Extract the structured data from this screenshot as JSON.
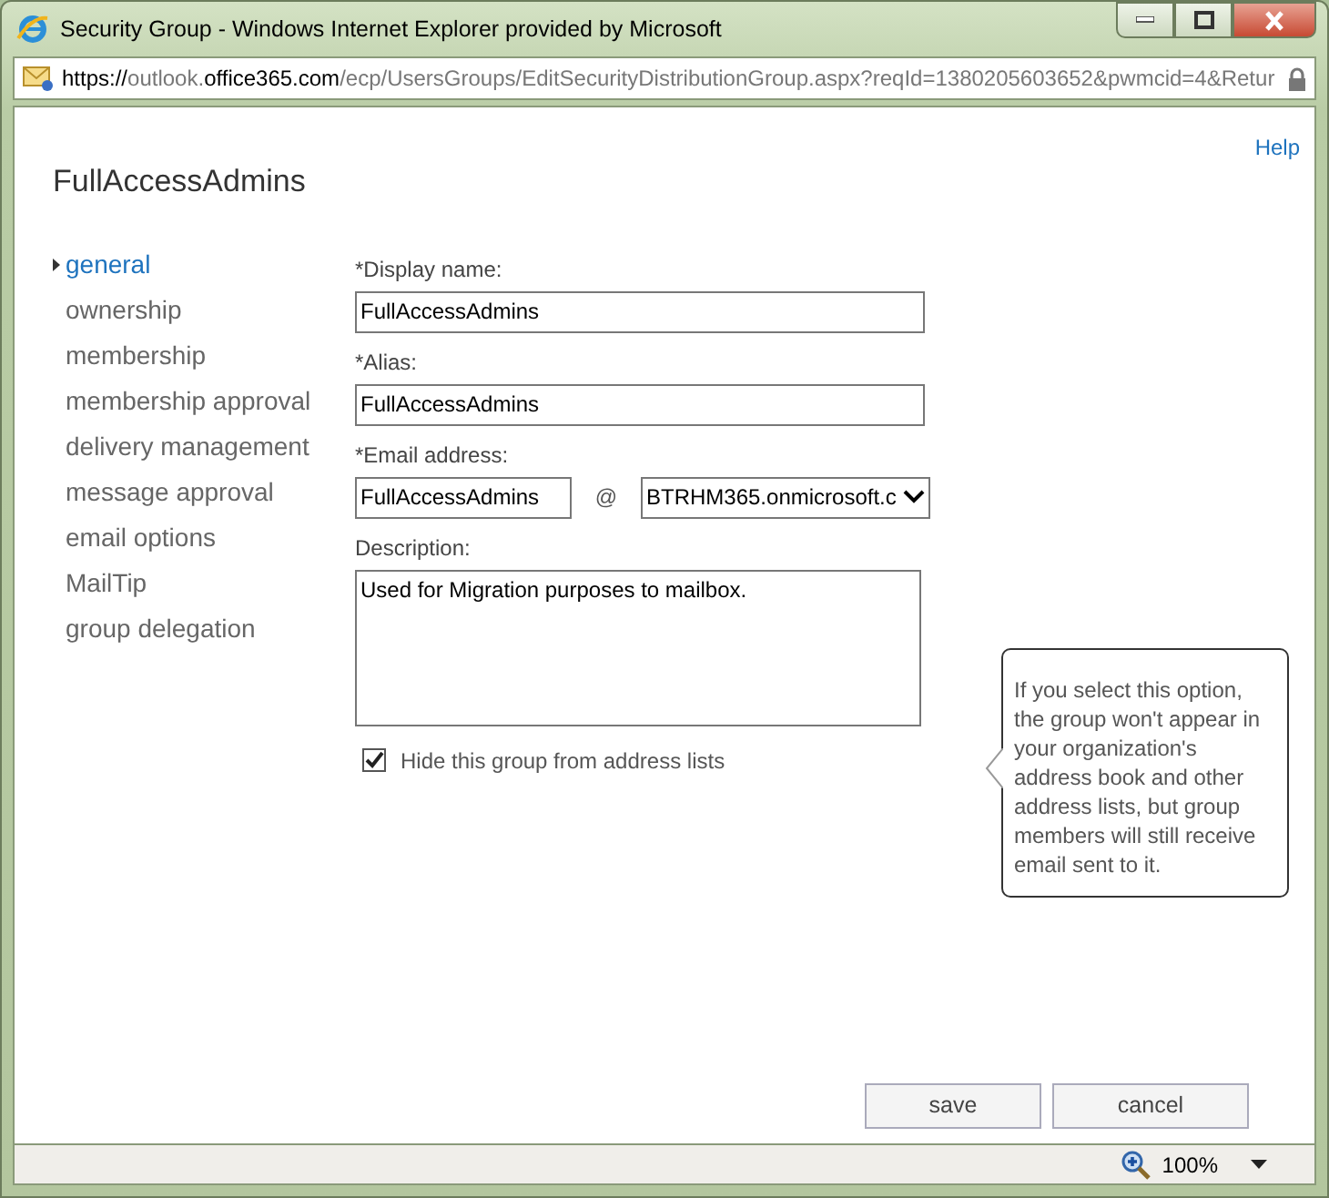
{
  "window": {
    "title": "Security Group - Windows Internet Explorer provided by Microsoft"
  },
  "address_bar": {
    "url": [
      {
        "text": "https://",
        "emphasis": true
      },
      {
        "text": "outlook.",
        "emphasis": false
      },
      {
        "text": "office365.com",
        "emphasis": true
      },
      {
        "text": "/ecp/UsersGroups/EditSecurityDistributionGroup.aspx?reqId=1380205603652&pwmcid=4&Retur",
        "emphasis": false
      }
    ]
  },
  "help_link": "Help",
  "page_title": "FullAccessAdmins",
  "nav": [
    {
      "label": "general",
      "selected": true
    },
    {
      "label": "ownership",
      "selected": false
    },
    {
      "label": "membership",
      "selected": false
    },
    {
      "label": "membership approval",
      "selected": false
    },
    {
      "label": "delivery management",
      "selected": false
    },
    {
      "label": "message approval",
      "selected": false
    },
    {
      "label": "email options",
      "selected": false
    },
    {
      "label": "MailTip",
      "selected": false
    },
    {
      "label": "group delegation",
      "selected": false
    }
  ],
  "form": {
    "display_name": {
      "label": "*Display name:",
      "value": "FullAccessAdmins"
    },
    "alias": {
      "label": "*Alias:",
      "value": "FullAccessAdmins"
    },
    "email": {
      "label": "*Email address:",
      "value": "FullAccessAdmins",
      "at": "@",
      "domain": "BTRHM365.onmicrosoft.c"
    },
    "description": {
      "label": "Description:",
      "value": "Used for Migration purposes to mailbox."
    },
    "hide_checkbox": {
      "label": "Hide this group from address lists",
      "checked": true
    }
  },
  "tooltip": "If you select this option, the group won't appear in your organization's address book and other address lists, but group members will still receive email sent to it.",
  "buttons": [
    "save",
    "cancel"
  ],
  "status_bar": {
    "zoom": "100%"
  }
}
